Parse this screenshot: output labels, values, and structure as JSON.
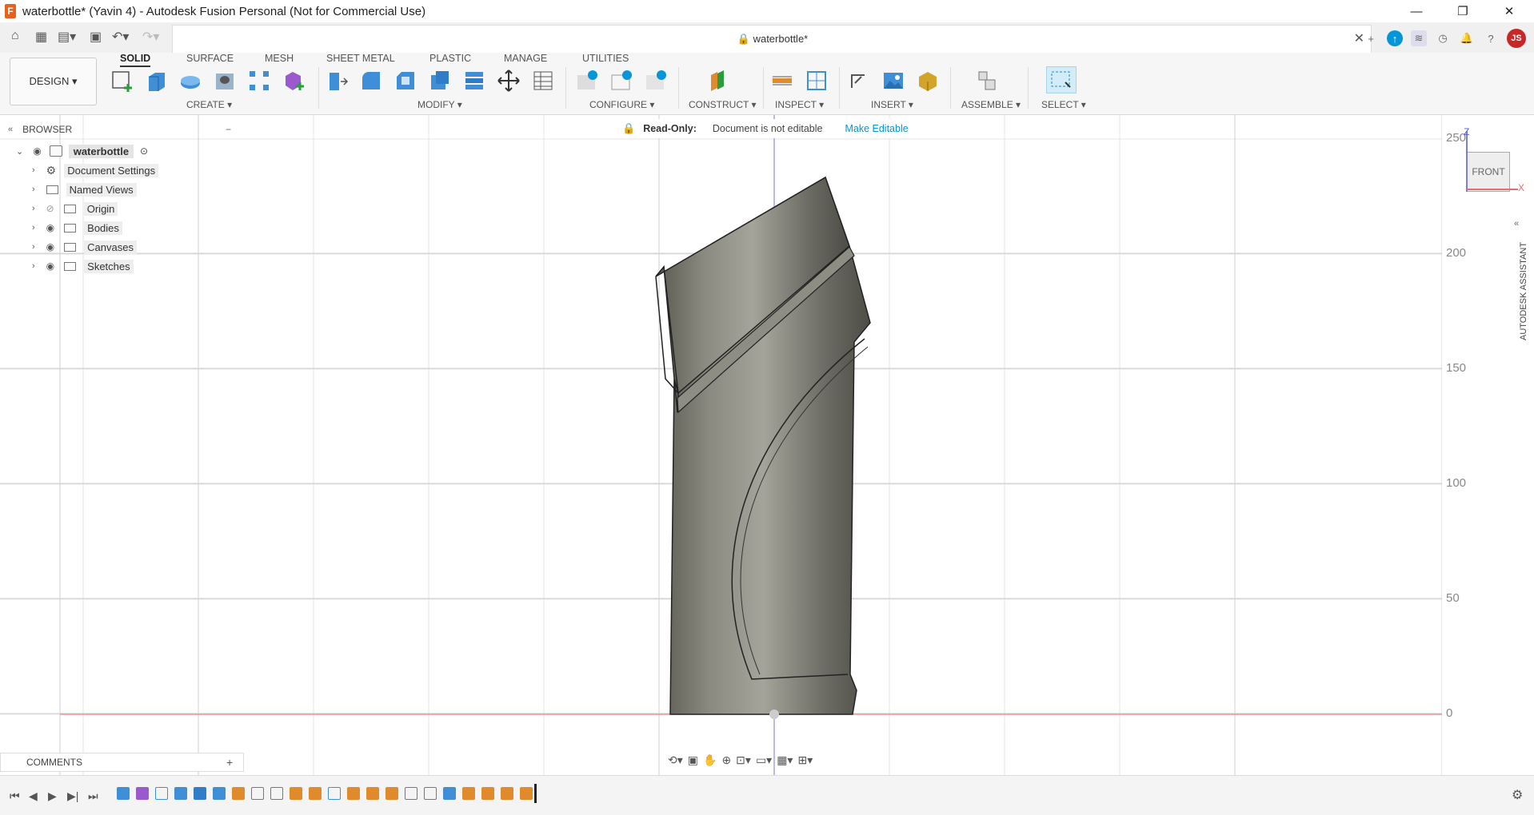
{
  "window": {
    "title": "waterbottle* (Yavin 4) - Autodesk Fusion Personal (Not for Commercial Use)",
    "app_icon_letter": "F",
    "controls": {
      "minimize": "—",
      "restore": "❐",
      "close": "✕"
    }
  },
  "document_tab": {
    "label": "waterbottle*",
    "close": "✕"
  },
  "ribbon": {
    "workspace": "DESIGN ▾",
    "tabs": [
      "SOLID",
      "SURFACE",
      "MESH",
      "SHEET METAL",
      "PLASTIC",
      "MANAGE",
      "UTILITIES"
    ],
    "active_tab": "SOLID",
    "groups": {
      "create": "CREATE ▾",
      "modify": "MODIFY ▾",
      "configure": "CONFIGURE ▾",
      "construct": "CONSTRUCT ▾",
      "inspect": "INSPECT ▾",
      "insert": "INSERT ▾",
      "assemble": "ASSEMBLE ▾",
      "select": "SELECT ▾"
    }
  },
  "browser": {
    "title": "BROWSER",
    "root": "waterbottle",
    "items": [
      "Document Settings",
      "Named Views",
      "Origin",
      "Bodies",
      "Canvases",
      "Sketches"
    ]
  },
  "readonly_bar": {
    "label": "Read-Only:",
    "message": "Document is not editable",
    "action": "Make Editable"
  },
  "viewcube": {
    "face": "FRONT",
    "z": "Z",
    "x": "X"
  },
  "axis_ticks": [
    "250",
    "200",
    "150",
    "100",
    "50",
    "0"
  ],
  "comments": {
    "title": "COMMENTS"
  },
  "assistant": {
    "label": "AUTODESK ASSISTANT"
  },
  "colors": {
    "accent": "#0696d7",
    "title_bar": "#ffffff",
    "avatar": "#c62828",
    "warning": "#f5a623"
  },
  "user_initials": "JS"
}
